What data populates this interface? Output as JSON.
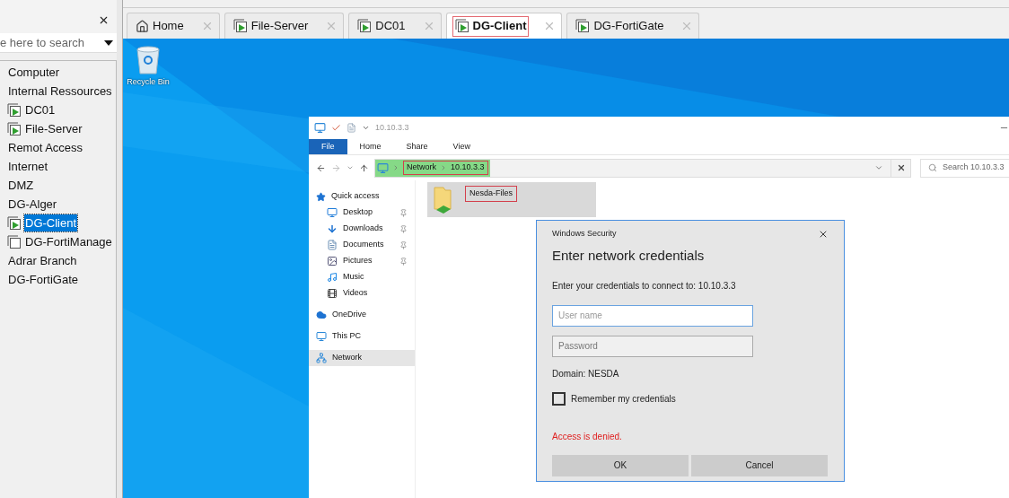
{
  "sidebar": {
    "search": {
      "value": "e here to search"
    },
    "items": [
      {
        "label": "Computer",
        "kind": "group",
        "selected": false
      },
      {
        "label": "Internal Ressources",
        "kind": "group",
        "selected": false
      },
      {
        "label": "DC01",
        "kind": "vm",
        "selected": false
      },
      {
        "label": "File-Server",
        "kind": "vm",
        "selected": false
      },
      {
        "label": "Remot Access",
        "kind": "group",
        "selected": false
      },
      {
        "label": "Internet",
        "kind": "group",
        "selected": false
      },
      {
        "label": "DMZ",
        "kind": "group",
        "selected": false
      },
      {
        "label": "DG-Alger",
        "kind": "group",
        "selected": false
      },
      {
        "label": "DG-Client",
        "kind": "vm",
        "selected": true
      },
      {
        "label": "DG-FortiManage",
        "kind": "vm-off",
        "selected": false
      },
      {
        "label": "Adrar Branch",
        "kind": "group",
        "selected": false
      },
      {
        "label": "DG-FortiGate",
        "kind": "group",
        "selected": false
      }
    ]
  },
  "tabs": [
    {
      "label": "Home",
      "kind": "home",
      "selected": false,
      "highlighted": false
    },
    {
      "label": "File-Server",
      "kind": "vm",
      "selected": false,
      "highlighted": false
    },
    {
      "label": "DC01",
      "kind": "vm",
      "selected": false,
      "highlighted": false
    },
    {
      "label": "DG-Client",
      "kind": "vm",
      "selected": true,
      "highlighted": true
    },
    {
      "label": "DG-FortiGate",
      "kind": "vm",
      "selected": false,
      "highlighted": false
    }
  ],
  "desktop": {
    "icons": [
      {
        "label": "Recycle Bin"
      }
    ]
  },
  "explorer": {
    "title": "10.10.3.3",
    "ribbon_tabs": [
      {
        "label": "File",
        "selected": true
      },
      {
        "label": "Home",
        "selected": false
      },
      {
        "label": "Share",
        "selected": false
      },
      {
        "label": "View",
        "selected": false
      }
    ],
    "address": {
      "highlighted": true,
      "crumbs_highlighted": true,
      "crumbs": [
        "Network",
        "10.10.3.3"
      ]
    },
    "search": {
      "placeholder": "Search 10.10.3.3"
    },
    "nav": [
      {
        "label": "Quick access",
        "kind": "star",
        "selected": false,
        "children": [
          {
            "label": "Desktop",
            "kind": "desktop",
            "pinned": true,
            "selected": false
          },
          {
            "label": "Downloads",
            "kind": "download",
            "pinned": true,
            "selected": false
          },
          {
            "label": "Documents",
            "kind": "document",
            "pinned": true,
            "selected": false
          },
          {
            "label": "Pictures",
            "kind": "pictures",
            "pinned": true,
            "selected": false
          },
          {
            "label": "Music",
            "kind": "music",
            "pinned": false,
            "selected": false
          },
          {
            "label": "Videos",
            "kind": "video",
            "pinned": false,
            "selected": false
          }
        ]
      },
      {
        "label": "OneDrive",
        "kind": "cloud",
        "selected": false
      },
      {
        "label": "This PC",
        "kind": "monitor",
        "selected": false
      },
      {
        "label": "Network",
        "kind": "network",
        "selected": true
      }
    ],
    "files": [
      {
        "label": "Nesda-Files",
        "selected": true,
        "highlighted": true
      }
    ]
  },
  "dialog": {
    "caption": "Windows Security",
    "title": "Enter network credentials",
    "prompt": "Enter your credentials to connect to: 10.10.3.3",
    "fields": [
      {
        "placeholder": "User name",
        "focused": true
      },
      {
        "placeholder": "Password",
        "focused": false
      }
    ],
    "domain": "Domain: NESDA",
    "remember": {
      "label": "Remember my credentials",
      "checked": false
    },
    "error": "Access is denied.",
    "buttons": [
      "OK",
      "Cancel"
    ]
  }
}
